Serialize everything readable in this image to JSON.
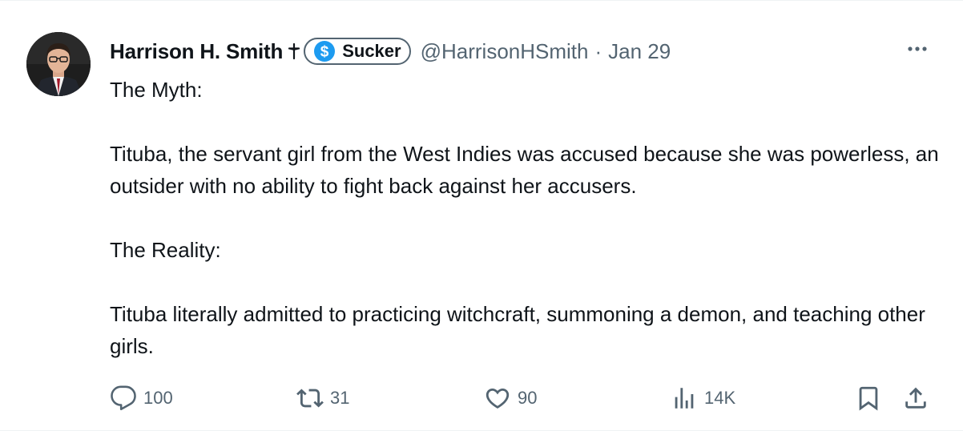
{
  "author": {
    "display_name": "Harrison H. Smith",
    "name_icon": "christian-cross-icon",
    "badge_label": "Sucker",
    "badge_icon": "dollar-circle-icon",
    "handle": "@HarrisonHSmith",
    "separator": "·",
    "date": "Jan 29"
  },
  "tweet": {
    "paragraphs": [
      "The Myth:",
      "Tituba, the servant girl from the West Indies was accused because she was powerless, an outsider with no ability to fight back against her accusers.",
      "The Reality:",
      "Tituba literally admitted to practicing witchcraft, summoning a demon, and teaching other girls."
    ]
  },
  "actions": {
    "replies": "100",
    "reposts": "31",
    "likes": "90",
    "views": "14K"
  },
  "colors": {
    "text_primary": "#0f1419",
    "text_secondary": "#536471",
    "badge_accent": "#1d9bf0"
  }
}
